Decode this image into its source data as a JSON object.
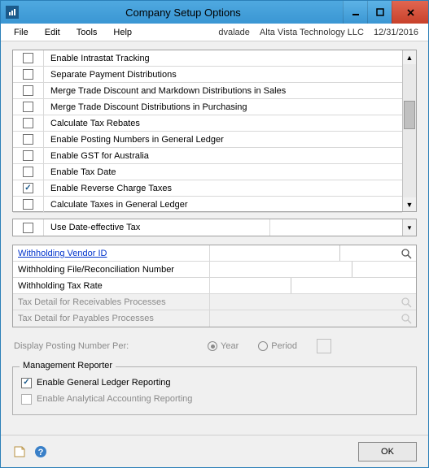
{
  "window": {
    "title": "Company Setup Options"
  },
  "menu": {
    "file": "File",
    "edit": "Edit",
    "tools": "Tools",
    "help": "Help",
    "user": "dvalade",
    "company": "Alta Vista Technology LLC",
    "date": "12/31/2016"
  },
  "options": [
    {
      "checked": false,
      "label": "Enable Intrastat Tracking"
    },
    {
      "checked": false,
      "label": "Separate Payment Distributions"
    },
    {
      "checked": false,
      "label": "Merge Trade Discount and Markdown Distributions in Sales"
    },
    {
      "checked": false,
      "label": "Merge Trade Discount Distributions in Purchasing"
    },
    {
      "checked": false,
      "label": "Calculate Tax Rebates"
    },
    {
      "checked": false,
      "label": "Enable Posting Numbers in General Ledger"
    },
    {
      "checked": false,
      "label": "Enable GST for Australia"
    },
    {
      "checked": false,
      "label": "Enable Tax Date"
    },
    {
      "checked": true,
      "label": "Enable Reverse Charge Taxes"
    },
    {
      "checked": false,
      "label": "Calculate Taxes in General Ledger"
    }
  ],
  "dateEffective": {
    "checked": false,
    "label": "Use Date-effective Tax",
    "combo_value": ""
  },
  "form": {
    "vendor_label": "Withholding Vendor ID",
    "vendor_value": "",
    "file_label": "Withholding File/Reconciliation Number",
    "file_value": "",
    "rate_label": "Withholding Tax Rate",
    "rate_value": "",
    "recv_label": "Tax Detail for Receivables Processes",
    "pay_label": "Tax Detail for Payables Processes"
  },
  "posting": {
    "label": "Display Posting Number Per:",
    "year": "Year",
    "period": "Period",
    "selected": "Year"
  },
  "mgmt": {
    "title": "Management Reporter",
    "gl_checked": true,
    "gl_label": "Enable General Ledger Reporting",
    "aa_checked": false,
    "aa_label": "Enable Analytical Accounting Reporting"
  },
  "buttons": {
    "ok": "OK"
  }
}
